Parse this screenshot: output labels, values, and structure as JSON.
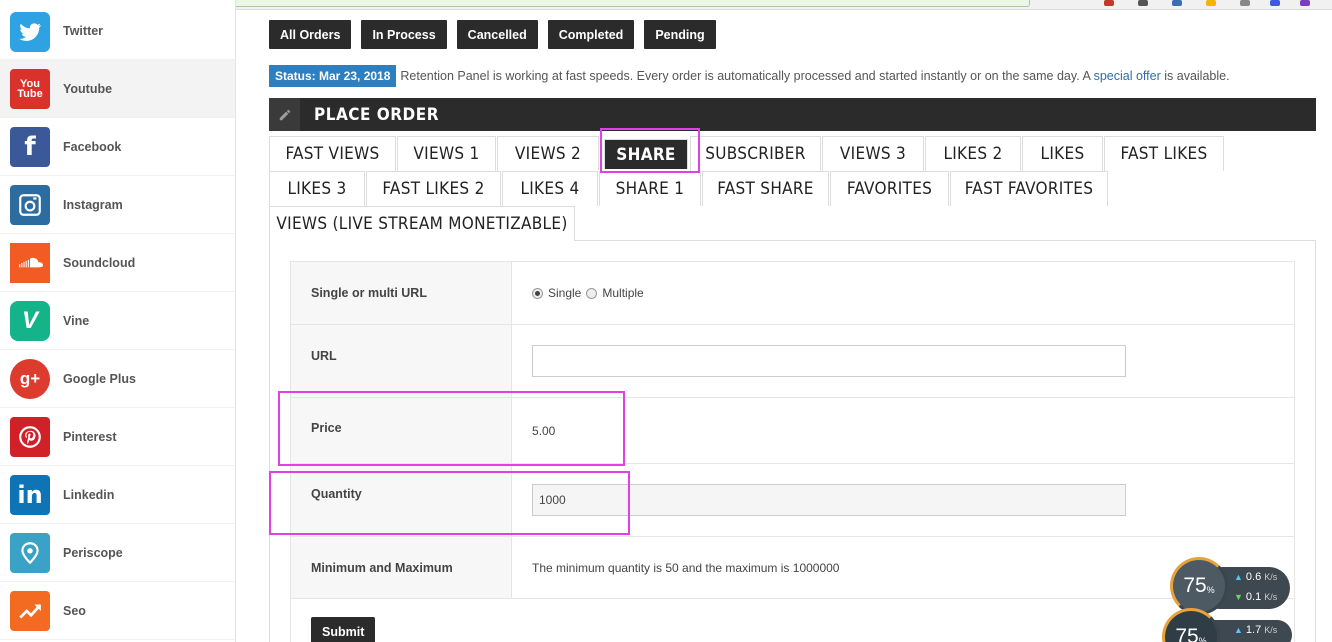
{
  "sidebar": {
    "items": [
      {
        "label": "Twitter",
        "icon": "twitter-icon",
        "color": "#2ea2e3"
      },
      {
        "label": "Youtube",
        "icon": "youtube-icon",
        "color": "#d9322d"
      },
      {
        "label": "Facebook",
        "icon": "facebook-icon",
        "color": "#3b5998"
      },
      {
        "label": "Instagram",
        "icon": "instagram-icon",
        "color": "#2d6c9f"
      },
      {
        "label": "Soundcloud",
        "icon": "soundcloud-icon",
        "color": "#f25b23"
      },
      {
        "label": "Vine",
        "icon": "vine-icon",
        "color": "#14b38a"
      },
      {
        "label": "Google Plus",
        "icon": "google-plus-icon",
        "color": "#dc3b2e"
      },
      {
        "label": "Pinterest",
        "icon": "pinterest-icon",
        "color": "#cf2127"
      },
      {
        "label": "Linkedin",
        "icon": "linkedin-icon",
        "color": "#0f74b5"
      },
      {
        "label": "Periscope",
        "icon": "periscope-icon",
        "color": "#3aa2c7"
      },
      {
        "label": "Seo",
        "icon": "seo-icon",
        "color": "#f26b21"
      }
    ]
  },
  "order_buttons": [
    "All Orders",
    "In Process",
    "Cancelled",
    "Completed",
    "Pending"
  ],
  "status": {
    "badge": "Status: Mar 23, 2018",
    "text_before": "Retention Panel is working at fast speeds. Every order is automatically processed and started instantly or on the same day. A ",
    "link": "special offer",
    "text_after": " is available."
  },
  "panel_title": "PLACE ORDER",
  "tabs_row1": [
    "FAST VIEWS",
    "VIEWS 1",
    "VIEWS 2",
    "SHARE",
    "SUBSCRIBER",
    "VIEWS 3",
    "LIKES 2",
    "LIKES",
    "FAST LIKES"
  ],
  "tabs_row2": [
    "LIKES 3",
    "FAST LIKES 2",
    "LIKES 4",
    "SHARE 1",
    "FAST SHARE",
    "FAVORITES",
    "FAST FAVORITES"
  ],
  "tabs_row3": [
    "VIEWS (LIVE STREAM MONETIZABLE)"
  ],
  "active_tab": "SHARE",
  "form": {
    "url_mode_label": "Single or multi URL",
    "single": "Single",
    "multiple": "Multiple",
    "url_label": "URL",
    "url_value": "",
    "price_label": "Price",
    "price_value": "5.00",
    "quantity_label": "Quantity",
    "quantity_value": "1000",
    "minmax_label": "Minimum and Maximum",
    "minmax_text": "The minimum quantity is 50 and the maximum is 1000000",
    "submit": "Submit"
  },
  "speed_widget": {
    "percent1": "75",
    "up1": "0.6",
    "down1": "0.1",
    "unit": "K/s",
    "percent2": "75",
    "up2": "1.7"
  },
  "colors": {
    "accent": "#2b2b2b",
    "status_blue": "#2d7fbf",
    "highlight": "#e040e6"
  }
}
